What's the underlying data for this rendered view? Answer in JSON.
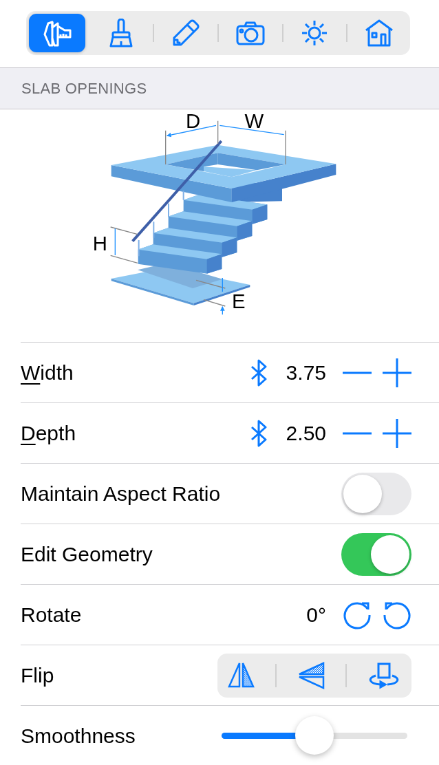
{
  "toolbar": [
    {
      "kind": "caliper",
      "selected": true
    },
    {
      "kind": "brush",
      "selected": false
    },
    {
      "kind": "pencil",
      "selected": false
    },
    {
      "kind": "camera",
      "selected": false
    },
    {
      "kind": "sun",
      "selected": false
    },
    {
      "kind": "house",
      "selected": false
    }
  ],
  "section": {
    "title": "SLAB OPENINGS"
  },
  "diagram": {
    "labels": [
      "D",
      "W",
      "H",
      "E"
    ]
  },
  "rows": [
    {
      "kind": "stepper",
      "label": "Width",
      "underline_first": true,
      "value": "3.75"
    },
    {
      "kind": "stepper",
      "label": "Depth",
      "underline_first": true,
      "value": "2.50"
    },
    {
      "kind": "toggle",
      "label": "Maintain Aspect Ratio",
      "on": false
    },
    {
      "kind": "toggle",
      "label": "Edit Geometry",
      "on": true
    },
    {
      "kind": "rotate",
      "label": "Rotate",
      "value": "0°"
    },
    {
      "kind": "flip",
      "label": "Flip"
    },
    {
      "kind": "slider",
      "label": "Smoothness",
      "level": 0.5
    }
  ]
}
